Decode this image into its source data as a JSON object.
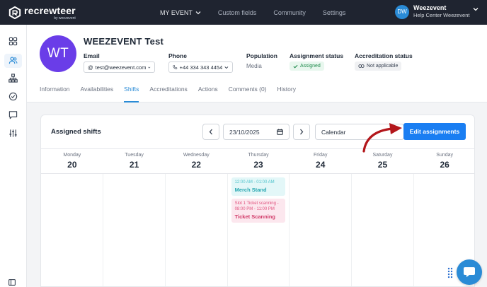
{
  "topbar": {
    "logo_text": "recrewteer",
    "logo_sub": "by weezevent",
    "nav": [
      {
        "label": "MY EVENT"
      },
      {
        "label": "Custom fields"
      },
      {
        "label": "Community"
      },
      {
        "label": "Settings"
      }
    ],
    "user": {
      "initials": "DW",
      "name": "Weezevent",
      "org": "Help Center Weezevent"
    }
  },
  "sidebar": {
    "icons": [
      "dashboard-icon",
      "users-icon",
      "org-chart-icon",
      "check-circle-icon",
      "message-icon",
      "sliders-icon"
    ],
    "active_index": 1,
    "toggle_icon": "sidebar-toggle-icon"
  },
  "profile": {
    "initials": "WT",
    "name": "WEEZEVENT Test",
    "email_label": "Email",
    "email_value": "test@weezevent.com",
    "phone_label": "Phone",
    "phone_value": "+44 334 343 4454",
    "population_label": "Population",
    "population_value": "Media",
    "assignment_label": "Assignment status",
    "assignment_value": "Assigned",
    "accreditation_label": "Accreditation status",
    "accreditation_value": "Not applicable"
  },
  "tabs": [
    {
      "label": "Information"
    },
    {
      "label": "Availabilities"
    },
    {
      "label": "Shifts"
    },
    {
      "label": "Accreditations"
    },
    {
      "label": "Actions"
    },
    {
      "label": "Comments (0)"
    },
    {
      "label": "History"
    }
  ],
  "active_tab": "Shifts",
  "shifts_card": {
    "title": "Assigned shifts",
    "date_value": "23/10/2025",
    "view_value": "Calendar",
    "edit_label": "Edit assignments",
    "days": [
      {
        "name": "Monday",
        "num": "20"
      },
      {
        "name": "Tuesday",
        "num": "21"
      },
      {
        "name": "Wednesday",
        "num": "22"
      },
      {
        "name": "Thursday",
        "num": "23"
      },
      {
        "name": "Friday",
        "num": "24"
      },
      {
        "name": "Saturday",
        "num": "25"
      },
      {
        "name": "Sunday",
        "num": "26"
      }
    ],
    "shifts": [
      {
        "time": "12:00 AM - 01:00 AM",
        "title": "Merch Stand",
        "color": "#26a6b0"
      },
      {
        "time": "Slot 1 Ticket scanning - 08:00 PM - 11:00 PM",
        "title": "Ticket Scanning",
        "color": "#d13a68"
      }
    ]
  },
  "colors": {
    "accent": "#2a8bd6",
    "primary_button": "#1a7ef2",
    "avatar": "#6a3de8",
    "arrow": "#b3161b"
  }
}
